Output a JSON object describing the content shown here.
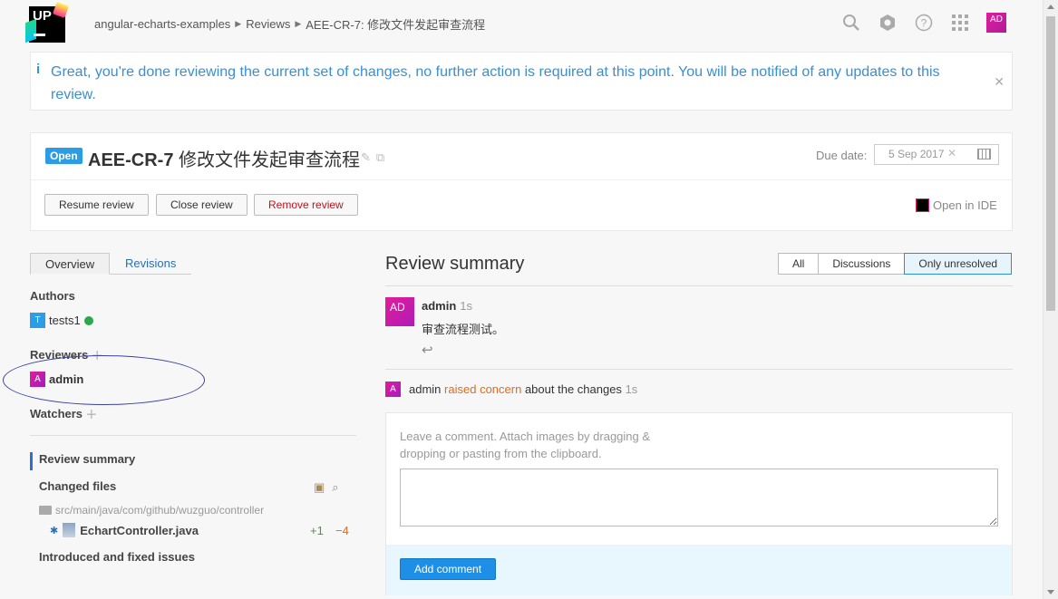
{
  "header": {
    "logo_text": "UP",
    "breadcrumb": [
      "angular-echarts-examples",
      "Reviews",
      "AEE-CR-7: 修改文件发起审查流程"
    ],
    "user_initials": "AD"
  },
  "banner": {
    "message": "Great, you're done reviewing the current set of changes, no further action is required at this point. You will be notified of any updates to this review."
  },
  "review": {
    "status": "Open",
    "id": "AEE-CR-7",
    "title": "修改文件发起审查流程",
    "due_label": "Due date:",
    "due_value": "5 Sep 2017",
    "buttons": {
      "resume": "Resume review",
      "close": "Close review",
      "remove": "Remove review"
    },
    "open_ide": "Open in IDE"
  },
  "sidebar": {
    "tabs": [
      "Overview",
      "Revisions"
    ],
    "authors_label": "Authors",
    "author": {
      "initial": "T",
      "name": "tests1"
    },
    "reviewers_label": "Reviewers",
    "reviewer": {
      "initial": "A",
      "name": "admin"
    },
    "watchers_label": "Watchers",
    "nav": {
      "review_summary": "Review summary",
      "changed_files": "Changed files",
      "path": "src/main/java/com/github/wuzguo/controller",
      "file": "EchartController.java",
      "added": "+1",
      "removed": "−4",
      "issues": "Introduced and fixed issues"
    }
  },
  "summary": {
    "title": "Review summary",
    "filters": [
      "All",
      "Discussions",
      "Only unresolved"
    ],
    "comment": {
      "avatar": "AD",
      "author": "admin",
      "time": "1s",
      "text": "审查流程测试。"
    },
    "event": {
      "avatar": "A",
      "author": "admin",
      "action": "raised concern",
      "rest": "about the changes",
      "time": "1s"
    },
    "comment_hint": "Leave a comment. Attach images by dragging & dropping or pasting from the clipboard.",
    "add_comment": "Add comment"
  }
}
